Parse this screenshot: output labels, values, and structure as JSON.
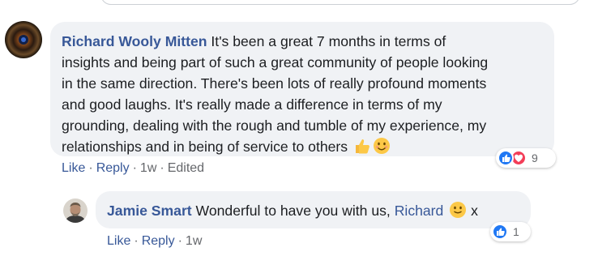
{
  "comments": [
    {
      "author": "Richard Wooly Mitten",
      "text_lines": [
        "It's been a great 7 months in terms of",
        "insights and being part of such a great community of people looking",
        "in the same direction. There's been lots of really profound moments",
        "and good laughs. It's really made a difference in terms of my",
        "grounding, dealing with the rough and tumble of my experience, my",
        "relationships and in being of service to others"
      ],
      "emojis": [
        "thumbs-up-emoji",
        "smiling-emoji"
      ],
      "reactions": {
        "icons": [
          "like-reaction-icon",
          "love-reaction-icon"
        ],
        "count": "9"
      },
      "actions": {
        "like": "Like",
        "reply": "Reply",
        "time": "1w",
        "edited": "Edited"
      }
    },
    {
      "author": "Jamie Smart",
      "text": "Wonderful to have you with us,",
      "mention": "Richard",
      "emoji": "slight-smile-emoji",
      "suffix": "x",
      "reactions": {
        "icons": [
          "like-reaction-icon"
        ],
        "count": "1"
      },
      "actions": {
        "like": "Like",
        "reply": "Reply",
        "time": "1w"
      }
    }
  ],
  "colors": {
    "author_link": "#385898",
    "bubble_bg": "#f0f2f5",
    "meta_text": "#65676b",
    "like_blue": "#2078f4",
    "love_red": "#f33e58"
  }
}
